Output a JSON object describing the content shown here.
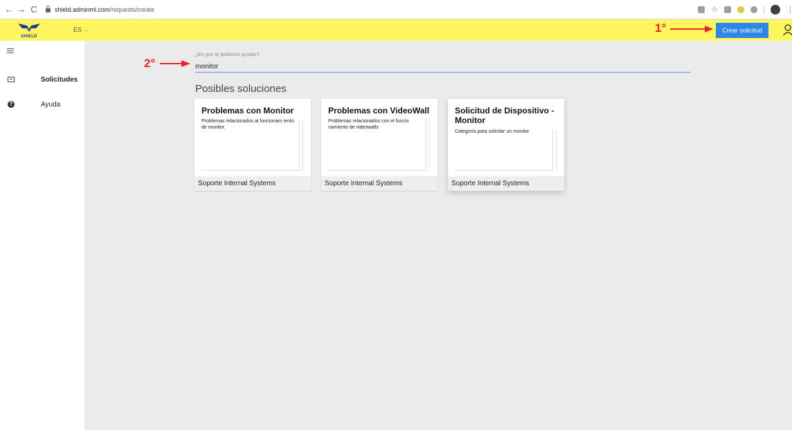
{
  "browser": {
    "url_host": "shield.adminml.com",
    "url_path": "/requests/create",
    "back_icon": "back-arrow-icon",
    "forward_icon": "forward-arrow-icon",
    "reload_icon": "reload-icon"
  },
  "header": {
    "logo_text": "SHIELD",
    "language": "ES",
    "create_button": "Crear solicitud",
    "background_color": "#fff55f",
    "button_color": "#2c87ea"
  },
  "annotations": {
    "first": "1°",
    "second": "2°",
    "color": "#e8262a"
  },
  "sidebar": {
    "items": [
      {
        "label": "Solicitudes",
        "icon": "ticket-icon",
        "active": true
      },
      {
        "label": "Ayuda",
        "icon": "help-icon",
        "active": false
      }
    ]
  },
  "search": {
    "label": "¿En que te podemos ayudar?",
    "value": "monitor"
  },
  "solutions": {
    "title": "Posibles soluciones",
    "cards": [
      {
        "title": "Problemas con Monitor",
        "description": "Problemas relacionados al funcionam iento de monitor.",
        "footer": "Soporte Internal Systems"
      },
      {
        "title": "Problemas con VideoWall",
        "description": "Problemas relacionados con el funcio namiento de videowalls",
        "footer": "Soporte Internal Systems"
      },
      {
        "title": "Solicitud de Dispositivo - Monitor",
        "description": "Categoría para solicitar un monitor",
        "footer": "Soporte Internal Systems"
      }
    ]
  }
}
